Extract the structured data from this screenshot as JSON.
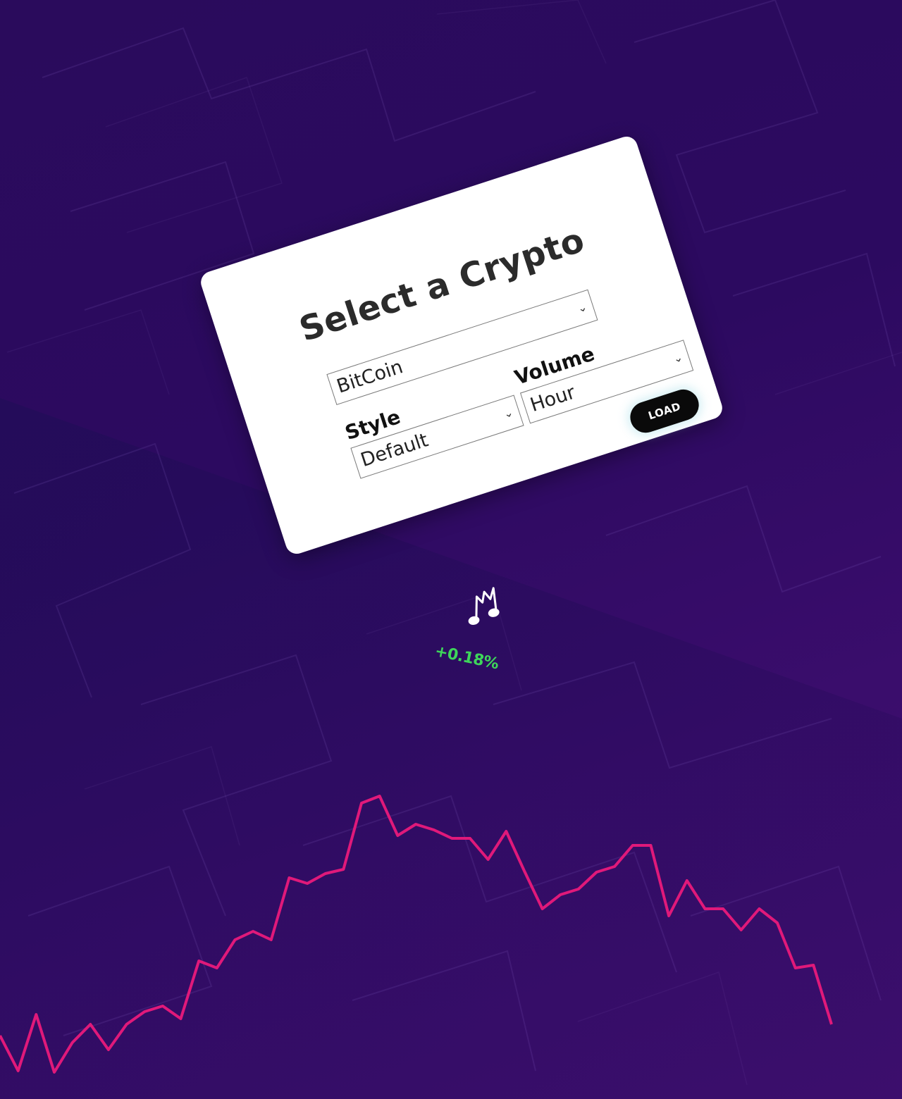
{
  "selector": {
    "title": "Select a Crypto",
    "crypto": {
      "value": "BitCoin"
    },
    "style": {
      "label": "Style",
      "value": "Default"
    },
    "volume": {
      "label": "Volume",
      "value": "Hour"
    },
    "load_label": "LOAD"
  },
  "icons": {
    "music": "music-note-icon",
    "chevron": "chevron-down-icon"
  },
  "change": {
    "text": "+0.18%",
    "color": "#3ed65a"
  },
  "colors": {
    "accent_line": "#e0197a",
    "background": "#2c0a60",
    "card": "#ffffff",
    "load_button": "#0a0a0a"
  },
  "chart_data": {
    "type": "line",
    "title": "",
    "xlabel": "",
    "ylabel": "",
    "x": [
      0,
      1,
      2,
      3,
      4,
      5,
      6,
      7,
      8,
      9,
      10,
      11,
      12,
      13,
      14,
      15,
      16,
      17,
      18,
      19,
      20,
      21,
      22,
      23,
      24,
      25,
      26,
      27,
      28,
      29,
      30,
      31,
      32,
      33,
      34,
      35,
      36,
      37,
      38,
      39,
      40,
      41,
      42,
      43,
      44,
      45,
      46
    ],
    "values": [
      0.4,
      0.15,
      0.55,
      0.14,
      0.35,
      0.48,
      0.3,
      0.48,
      0.57,
      0.61,
      0.52,
      0.93,
      0.88,
      1.08,
      1.14,
      1.08,
      1.52,
      1.48,
      1.55,
      1.58,
      2.05,
      2.1,
      1.82,
      1.9,
      1.86,
      1.8,
      1.8,
      1.65,
      1.85,
      1.57,
      1.3,
      1.4,
      1.44,
      1.56,
      1.6,
      1.75,
      1.75,
      1.25,
      1.5,
      1.3,
      1.3,
      1.15,
      1.3,
      1.2,
      0.88,
      0.9,
      0.48
    ],
    "ylim": [
      0,
      2.2
    ],
    "grid": false,
    "legend": "none"
  }
}
